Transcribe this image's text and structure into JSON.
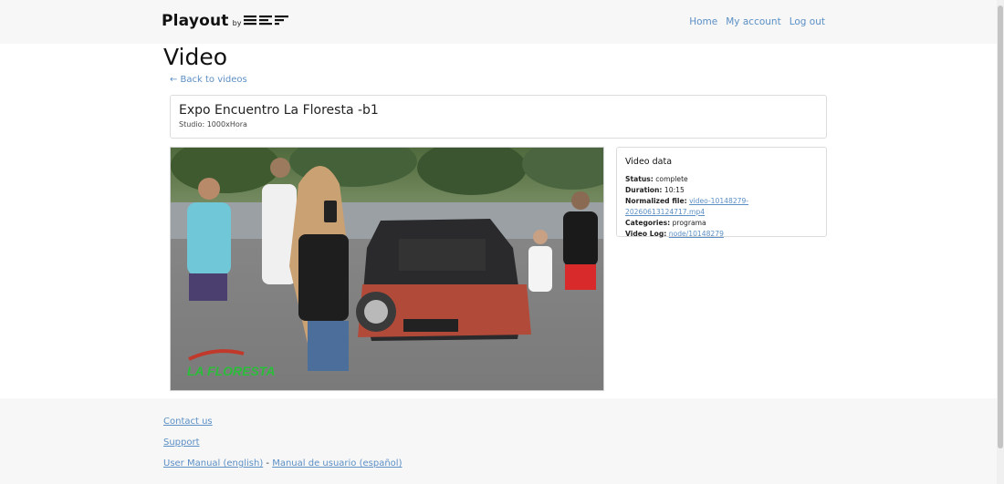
{
  "header": {
    "brand_name": "Playout",
    "brand_by": "by",
    "nav": {
      "home": "Home",
      "my_account": "My account",
      "log_out": "Log out"
    }
  },
  "main": {
    "page_title": "Video",
    "back_link": "← Back to videos",
    "video_title": "Expo Encuentro La Floresta -b1",
    "studio_line": "Studio: 1000xHora",
    "thumbnail": {
      "watermark_text": "LA FLORESTA"
    },
    "video_data": {
      "heading": "Video data",
      "status_label": "Status:",
      "status_value": "complete",
      "duration_label": "Duration:",
      "duration_value": "10:15",
      "normalized_label": "Normalized file:",
      "normalized_value": "video-10148279-20260613124717.mp4",
      "categories_label": "Categories:",
      "categories_value": "programa",
      "log_label": "Video Log:",
      "log_value": "node/10148279"
    }
  },
  "footer": {
    "contact": "Contact us",
    "support": "Support",
    "manual_en": "User Manual (english)",
    "manual_sep": " - ",
    "manual_es": "Manual de usuario (español)"
  }
}
